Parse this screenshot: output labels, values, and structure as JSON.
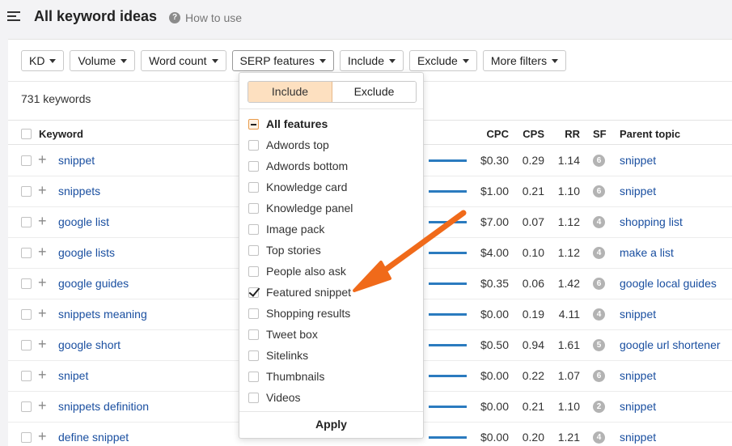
{
  "header": {
    "title": "All keyword ideas",
    "help_label": "How to use",
    "help_icon": "?"
  },
  "filters": [
    {
      "label": "KD"
    },
    {
      "label": "Volume"
    },
    {
      "label": "Word count"
    },
    {
      "label": "SERP features"
    },
    {
      "label": "Include"
    },
    {
      "label": "Exclude"
    },
    {
      "label": "More filters"
    }
  ],
  "keyword_count": "731 keywords",
  "columns": {
    "keyword": "Keyword",
    "cpc": "CPC",
    "cps": "CPS",
    "rr": "RR",
    "sf": "SF",
    "parent": "Parent topic"
  },
  "rows": [
    {
      "keyword": "snippet",
      "cpc": "$0.30",
      "cps": "0.29",
      "rr": "1.14",
      "sf": "6",
      "parent": "snippet"
    },
    {
      "keyword": "snippets",
      "cpc": "$1.00",
      "cps": "0.21",
      "rr": "1.10",
      "sf": "6",
      "parent": "snippet"
    },
    {
      "keyword": "google list",
      "cpc": "$7.00",
      "cps": "0.07",
      "rr": "1.12",
      "sf": "4",
      "parent": "shopping list"
    },
    {
      "keyword": "google lists",
      "cpc": "$4.00",
      "cps": "0.10",
      "rr": "1.12",
      "sf": "4",
      "parent": "make a list"
    },
    {
      "keyword": "google guides",
      "cpc": "$0.35",
      "cps": "0.06",
      "rr": "1.42",
      "sf": "6",
      "parent": "google local guides"
    },
    {
      "keyword": "snippets meaning",
      "cpc": "$0.00",
      "cps": "0.19",
      "rr": "4.11",
      "sf": "4",
      "parent": "snippet"
    },
    {
      "keyword": "google short",
      "cpc": "$0.50",
      "cps": "0.94",
      "rr": "1.61",
      "sf": "5",
      "parent": "google url shortener"
    },
    {
      "keyword": "snipet",
      "cpc": "$0.00",
      "cps": "0.22",
      "rr": "1.07",
      "sf": "6",
      "parent": "snippet"
    },
    {
      "keyword": "snippets definition",
      "cpc": "$0.00",
      "cps": "0.21",
      "rr": "1.10",
      "sf": "2",
      "parent": "snippet"
    },
    {
      "keyword": "define snippet",
      "cpc": "$0.00",
      "cps": "0.20",
      "rr": "1.21",
      "sf": "4",
      "parent": "snippet"
    }
  ],
  "serp_dropdown": {
    "include_label": "Include",
    "exclude_label": "Exclude",
    "options": [
      {
        "label": "All features",
        "state": "mixed"
      },
      {
        "label": "Adwords top",
        "state": "unchecked"
      },
      {
        "label": "Adwords bottom",
        "state": "unchecked"
      },
      {
        "label": "Knowledge card",
        "state": "unchecked"
      },
      {
        "label": "Knowledge panel",
        "state": "unchecked"
      },
      {
        "label": "Image pack",
        "state": "unchecked"
      },
      {
        "label": "Top stories",
        "state": "unchecked"
      },
      {
        "label": "People also ask",
        "state": "unchecked"
      },
      {
        "label": "Featured snippet",
        "state": "checked"
      },
      {
        "label": "Shopping results",
        "state": "unchecked"
      },
      {
        "label": "Tweet box",
        "state": "unchecked"
      },
      {
        "label": "Sitelinks",
        "state": "unchecked"
      },
      {
        "label": "Thumbnails",
        "state": "unchecked"
      },
      {
        "label": "Videos",
        "state": "unchecked"
      }
    ],
    "apply_label": "Apply"
  },
  "colors": {
    "accent": "#f06a1a",
    "link": "#1a4fa0",
    "volume_bar": "#2b7bbf",
    "include_active": "#fde0c0"
  }
}
